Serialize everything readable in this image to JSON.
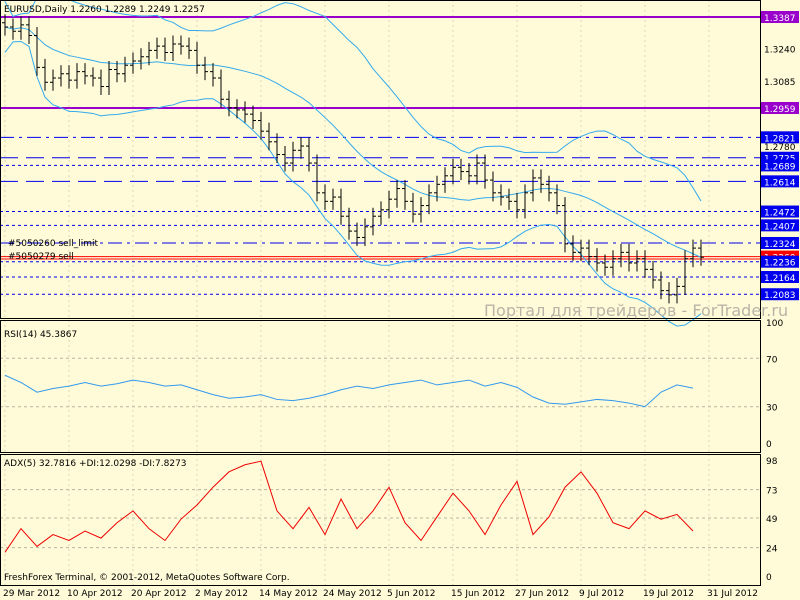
{
  "header": {
    "symbol_title": "EURUSD,Daily  1.2260 1.2289 1.2249 1.2257"
  },
  "watermark": "Портал для трейдеров - ForTrader.ru",
  "footer": "FreshForex Terminal, © 2001-2012, MetaQuotes Software Corp.",
  "orders": [
    {
      "label": "#5050260 sell_limit",
      "price": 1.2324
    },
    {
      "label": "#5050279 sell",
      "price": 1.226
    }
  ],
  "colors": {
    "background": "#FFFBD8",
    "bars": "#000000",
    "bands": "#33AAEE",
    "purple": "#9900CC",
    "blue": "#0000EE",
    "red": "#FF0000",
    "rsi": "#3399EE",
    "adx": "#EE0000"
  },
  "chart_data": [
    {
      "type": "ohlc",
      "title": "EURUSD,Daily",
      "price_range": [
        1.1971,
        1.3467
      ],
      "x_tick_labels": [
        "29 Mar 2012",
        "10 Apr 2012",
        "20 Apr 2012",
        "2 May 2012",
        "14 May 2012",
        "24 May 2012",
        "5 Jun 2012",
        "15 Jun 2012",
        "27 Jun 2012",
        "9 Jul 2012",
        "19 Jul 2012",
        "31 Jul 2012"
      ],
      "x_tick_bars": [
        0,
        8,
        16,
        24,
        32,
        40,
        48,
        56,
        64,
        72,
        80,
        88
      ],
      "y_ticks": [
        "1.3240",
        "1.3085",
        "1.2780"
      ],
      "closes": [
        1.334,
        1.332,
        1.335,
        1.33,
        1.315,
        1.308,
        1.31,
        1.312,
        1.309,
        1.313,
        1.311,
        1.31,
        1.306,
        1.314,
        1.312,
        1.316,
        1.318,
        1.32,
        1.323,
        1.325,
        1.322,
        1.326,
        1.325,
        1.323,
        1.316,
        1.313,
        1.31,
        1.3,
        1.296,
        1.295,
        1.293,
        1.29,
        1.285,
        1.28,
        1.274,
        1.27,
        1.276,
        1.278,
        1.27,
        1.256,
        1.252,
        1.254,
        1.245,
        1.238,
        1.235,
        1.24,
        1.245,
        1.248,
        1.253,
        1.258,
        1.252,
        1.246,
        1.25,
        1.256,
        1.26,
        1.264,
        1.268,
        1.266,
        1.264,
        1.27,
        1.262,
        1.256,
        1.254,
        1.252,
        1.248,
        1.256,
        1.263,
        1.26,
        1.256,
        1.25,
        1.232,
        1.228,
        1.23,
        1.226,
        1.223,
        1.221,
        1.225,
        1.228,
        1.223,
        1.225,
        1.22,
        1.215,
        1.21,
        1.208,
        1.212,
        1.225,
        1.23,
        1.2257
      ],
      "levels": [
        {
          "price": "1.3387",
          "style": "solid",
          "color": "purple"
        },
        {
          "price": "1.2959",
          "style": "solid",
          "color": "purple"
        },
        {
          "price": "1.2821",
          "style": "dashdot",
          "color": "blue"
        },
        {
          "price": "1.2725",
          "style": "longdash",
          "color": "blue"
        },
        {
          "price": "1.2689",
          "style": "dot",
          "color": "blue"
        },
        {
          "price": "1.2614",
          "style": "longdash",
          "color": "blue"
        },
        {
          "price": "1.2472",
          "style": "dot",
          "color": "blue"
        },
        {
          "price": "1.2407",
          "style": "dot",
          "color": "blue"
        },
        {
          "price": "1.2324",
          "style": "dashdot",
          "color": "blue"
        },
        {
          "price": "1.2260",
          "style": "solid",
          "color": "red"
        },
        {
          "price": "1.2236",
          "style": "dot",
          "color": "blue"
        },
        {
          "price": "1.2164",
          "style": "dot",
          "color": "blue"
        },
        {
          "price": "1.2083",
          "style": "dot",
          "color": "blue"
        }
      ]
    },
    {
      "type": "line",
      "title": "RSI(14) 45.3867",
      "ylim": [
        0,
        100
      ],
      "y_ticks": [
        "100",
        "70",
        "30",
        "0"
      ],
      "points_every_bars": 2,
      "values": [
        56,
        50,
        42,
        45,
        47,
        50,
        47,
        49,
        52,
        50,
        47,
        48,
        44,
        40,
        37,
        38,
        40,
        36,
        35,
        37,
        40,
        44,
        47,
        45,
        48,
        50,
        52,
        48,
        50,
        52,
        47,
        50,
        46,
        38,
        33,
        32,
        34,
        36,
        35,
        33,
        30,
        42,
        48,
        45.39
      ]
    },
    {
      "type": "line",
      "title": "ADX(5) 32.7816 +DI:12.0298 -DI:7.8273",
      "ylim": [
        0,
        98
      ],
      "y_ticks": [
        "98",
        "73",
        "49",
        "24",
        "0"
      ],
      "points_every_bars": 2,
      "values": [
        20,
        40,
        25,
        35,
        30,
        38,
        32,
        45,
        55,
        40,
        30,
        48,
        60,
        75,
        88,
        94,
        97,
        55,
        40,
        58,
        35,
        65,
        40,
        55,
        75,
        45,
        30,
        50,
        70,
        55,
        35,
        60,
        80,
        35,
        50,
        75,
        88,
        70,
        45,
        40,
        55,
        48,
        52,
        38
      ]
    }
  ]
}
